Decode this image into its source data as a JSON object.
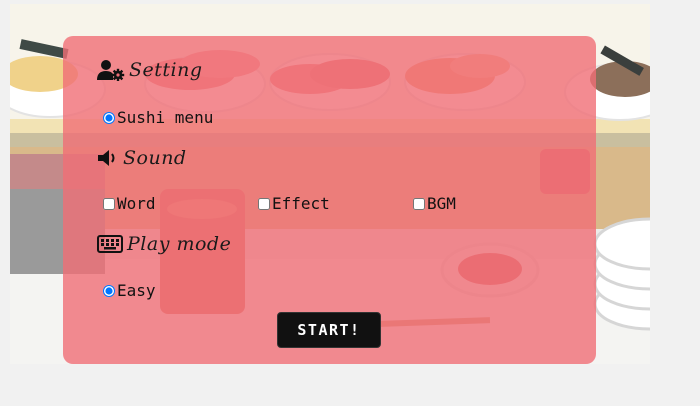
{
  "colors": {
    "panel": "#f06e76",
    "page_bg": "#f1f1f1",
    "button_bg": "#111111",
    "button_text": "#ffffff"
  },
  "settings": {
    "title": "Setting",
    "icon": "user-gear-icon",
    "options": [
      {
        "label": "Sushi menu",
        "type": "radio",
        "checked": true
      }
    ]
  },
  "sound": {
    "title": "Sound",
    "icon": "speaker-icon",
    "options": [
      {
        "label": "Word",
        "type": "checkbox",
        "checked": false
      },
      {
        "label": "Effect",
        "type": "checkbox",
        "checked": false
      },
      {
        "label": "BGM",
        "type": "checkbox",
        "checked": false
      }
    ]
  },
  "play_mode": {
    "title": "Play mode",
    "icon": "keyboard-icon",
    "options": [
      {
        "label": "Easy",
        "type": "radio",
        "checked": true
      }
    ]
  },
  "start_button": {
    "label": "START!"
  }
}
